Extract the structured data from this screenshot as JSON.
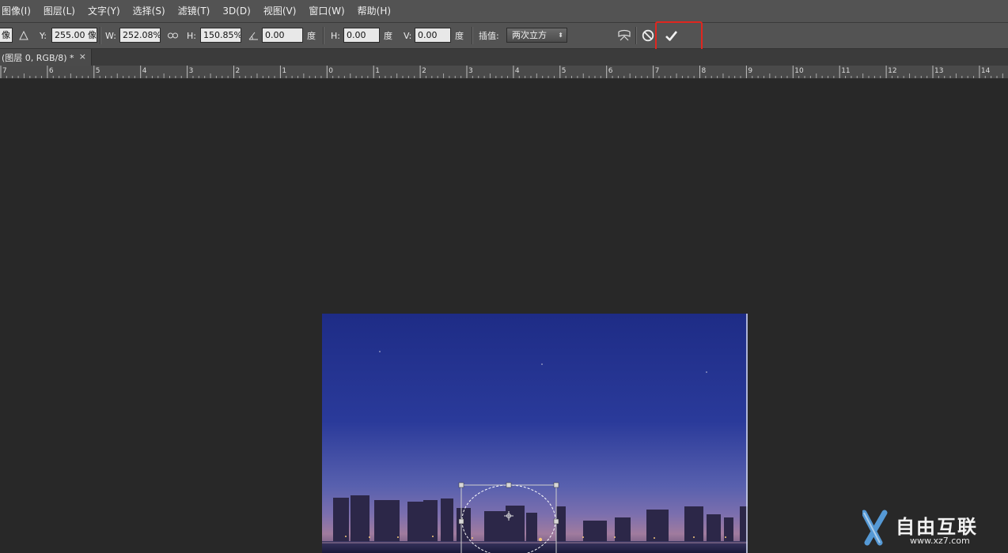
{
  "menubar": {
    "items": [
      "图像(I)",
      "图层(L)",
      "文字(Y)",
      "选择(S)",
      "滤镜(T)",
      "3D(D)",
      "视图(V)",
      "窗口(W)",
      "帮助(H)"
    ]
  },
  "options": {
    "x_partial": "像",
    "y_label": "Y:",
    "y_value": "255.00 像",
    "w_label": "W:",
    "w_value": "252.08%",
    "h_label": "H:",
    "h_value": "150.85%",
    "angle_value": "0.00",
    "degree": "度",
    "skew_h_label": "H:",
    "skew_h_value": "0.00",
    "skew_v_label": "V:",
    "skew_v_value": "0.00",
    "interp_label": "插值:",
    "interp_value": "两次立方",
    "icons": [
      "reference-point-icon",
      "link-icon",
      "angle-icon",
      "warp-icon",
      "cancel-icon",
      "commit-checkmark-icon"
    ]
  },
  "document": {
    "tab_label": "(图层 0, RGB/8) *",
    "close_symbol": "×"
  },
  "ruler": {
    "labels": [
      "7",
      "6",
      "5",
      "4",
      "3",
      "2",
      "1",
      "0",
      "1",
      "2",
      "3",
      "4",
      "5",
      "6",
      "7",
      "8",
      "9",
      "10",
      "11",
      "12",
      "13",
      "14"
    ]
  },
  "watermark": {
    "brand": "自由互联",
    "url": "www.xz7.com"
  },
  "colors": {
    "menubar_bg": "#535353",
    "workspace_bg": "#282828",
    "highlight": "#e0261f",
    "sky_top": "#1e2c86",
    "sky_bottom": "#6f69b2"
  }
}
